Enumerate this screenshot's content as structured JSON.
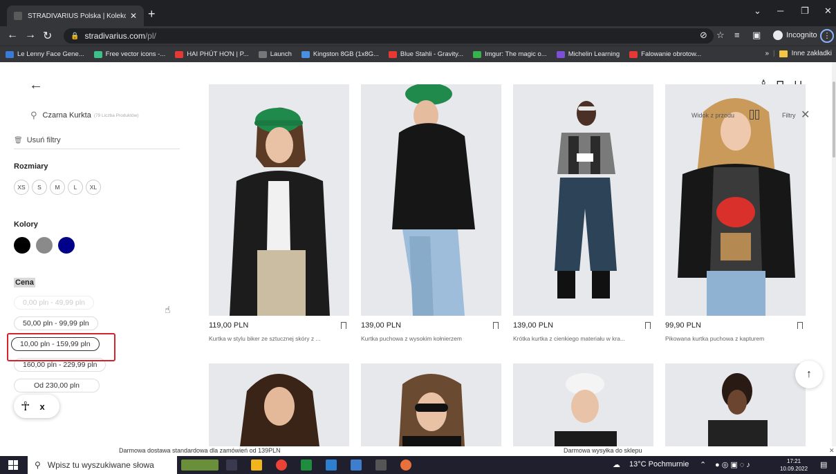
{
  "browser": {
    "tab_title": "STRADIVARIUS Polska | Kolekcja",
    "new_tab": "+",
    "url_host": "stradivarius.com",
    "url_path": "/pl/",
    "incognito_label": "Incognito",
    "bookmarks": [
      {
        "label": "Le Lenny Face Gene...",
        "color": "#3b7bd8"
      },
      {
        "label": "Free vector icons -...",
        "color": "#3fbf8a"
      },
      {
        "label": "HAI PHÚT HƠN | P...",
        "color": "#e53935"
      },
      {
        "label": "Launch",
        "color": "#777777"
      },
      {
        "label": "Kingston 8GB (1x8G...",
        "color": "#4a90e2"
      },
      {
        "label": "Blue Stahli - Gravity...",
        "color": "#e53935"
      },
      {
        "label": "Imgur: The magic o...",
        "color": "#37b24d"
      },
      {
        "label": "Michelin Learning",
        "color": "#7b4fd6"
      },
      {
        "label": "Falowanie obrotow...",
        "color": "#e53935"
      }
    ],
    "bookmarks_more": "»",
    "other_bookmarks": "Inne zakładki"
  },
  "sidebar": {
    "search_query": "Czarna Kurkta",
    "search_count": "(79 Liczba Produktów)",
    "clear_filters": "Usuń filtry",
    "sizes_title": "Rozmiary",
    "sizes": [
      "XS",
      "S",
      "M",
      "L",
      "XL"
    ],
    "colors_title": "Kolory",
    "colors": [
      "#000000",
      "#8a8a8a",
      "#00008b"
    ],
    "price_title": "Cena",
    "price_options": [
      {
        "label": "0,00 pln - 49,99 pln",
        "state": "faded"
      },
      {
        "label": "50,00 pln - 99,99 pln",
        "state": "normal"
      },
      {
        "label": "10,00 pln - 159,99 pln",
        "state": "selected"
      },
      {
        "label": "160,00 pln - 229,99 pln",
        "state": "normal"
      },
      {
        "label": "Od 230,00 pln",
        "state": "normal"
      }
    ],
    "a11y_close": "x"
  },
  "header": {
    "view_label": "Widok z przodu",
    "filters_label": "Filtry"
  },
  "products": [
    {
      "price": "119,00 PLN",
      "desc": "Kurtka w stylu biker ze sztucznej skóry z ..."
    },
    {
      "price": "139,00 PLN",
      "desc": "Kurtka puchowa z wysokim kołnierzem"
    },
    {
      "price": "139,00 PLN",
      "desc": "Krótka kurtka z cienkiego materiału w kra..."
    },
    {
      "price": "99,90 PLN",
      "desc": "Pikowana kurtka puchowa z kapturem"
    }
  ],
  "promo": {
    "left": "Darmowa dostawa standardowa dla zamówień od 139PLN",
    "right": "Darmowa wysyłka do sklepu"
  },
  "taskbar": {
    "search_placeholder": "Wpisz tu wyszukiwane słowa",
    "weather": "13°C Pochmurnie",
    "time": "17:21",
    "date": "10.09.2022"
  }
}
